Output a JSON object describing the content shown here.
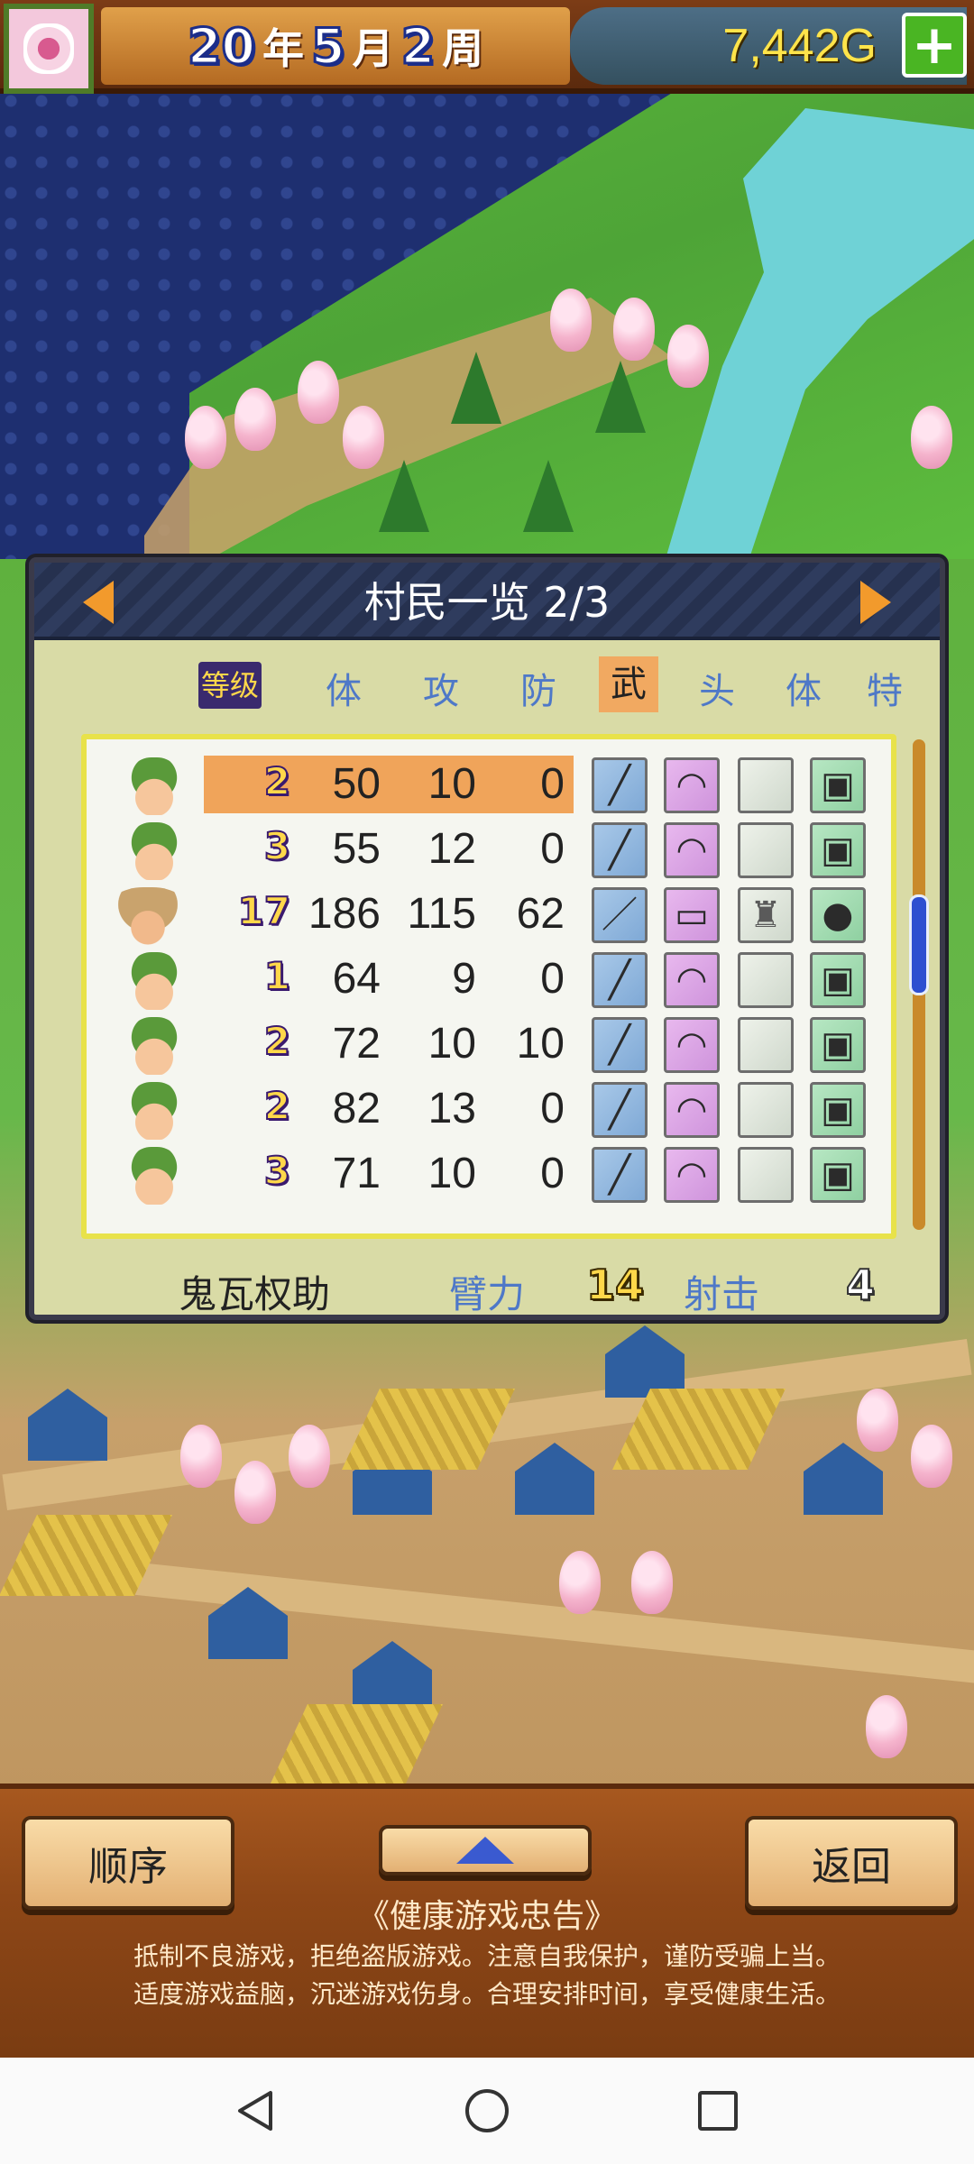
{
  "hud": {
    "year": "20",
    "year_unit": "年",
    "month": "5",
    "month_unit": "月",
    "week": "2",
    "week_unit": "周",
    "gold": "7,442G",
    "plus_label": "+"
  },
  "panel": {
    "title": "村民一览 2/3",
    "columns": [
      "等级",
      "体",
      "攻",
      "防",
      "武",
      "头",
      "体",
      "特"
    ],
    "active_column": "武",
    "rows": [
      {
        "level": "2",
        "hp": "50",
        "atk": "10",
        "def": "0",
        "selected": true
      },
      {
        "level": "3",
        "hp": "55",
        "atk": "12",
        "def": "0"
      },
      {
        "level": "17",
        "hp": "186",
        "atk": "115",
        "def": "62"
      },
      {
        "level": "1",
        "hp": "64",
        "atk": "9",
        "def": "0"
      },
      {
        "level": "2",
        "hp": "72",
        "atk": "10",
        "def": "10"
      },
      {
        "level": "2",
        "hp": "82",
        "atk": "13",
        "def": "0"
      },
      {
        "level": "3",
        "hp": "71",
        "atk": "10",
        "def": "0"
      }
    ],
    "footer": {
      "name": "鬼瓦权助",
      "stat1_label": "臂力",
      "stat1_value": "14",
      "stat2_label": "射击",
      "stat2_value": "4"
    }
  },
  "bottom": {
    "order_label": "顺序",
    "back_label": "返回",
    "notice_title": "《健康游戏忠告》",
    "notice_line1": "抵制不良游戏，拒绝盗版游戏。注意自我保护，谨防受骗上当。",
    "notice_line2": "适度游戏益脑，沉迷游戏伤身。合理安排时间，享受健康生活。"
  },
  "icons": {
    "weapon_default": "sickle-icon",
    "head_default": "straw-hat-icon",
    "special_default": "charm-icon",
    "accent": "#f29a2c"
  }
}
